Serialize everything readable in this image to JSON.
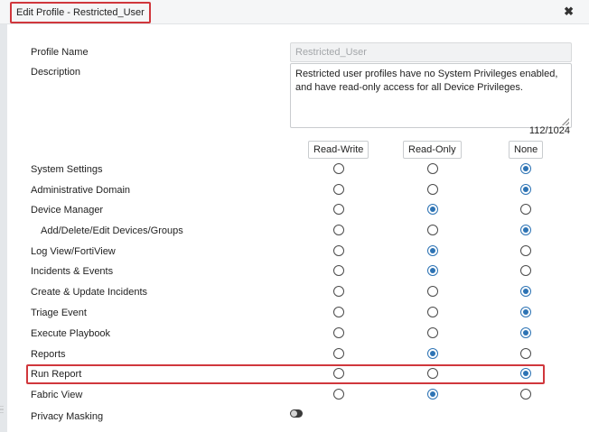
{
  "dialog": {
    "title": "Edit Profile - Restricted_User",
    "close_glyph": "✖",
    "close_icon": "close-icon",
    "grip_icon": "drag-grip-icon"
  },
  "form": {
    "profile_name_label": "Profile Name",
    "profile_name_value": "Restricted_User",
    "description_label": "Description",
    "description_value": "Restricted user profiles have no System Privileges enabled, and have read-only access for all Device Privileges.",
    "char_count": "112/1024"
  },
  "columns": [
    "Read-Write",
    "Read-Only",
    "None"
  ],
  "colors": {
    "accent": "#2d73b4",
    "highlight": "#d0373c"
  },
  "privileges": [
    {
      "label": "System Settings",
      "selected": "None"
    },
    {
      "label": "Administrative Domain",
      "selected": "None"
    },
    {
      "label": "Device Manager",
      "selected": "Read-Only"
    },
    {
      "label": "Add/Delete/Edit Devices/Groups",
      "selected": "None"
    },
    {
      "label": "Log View/FortiView",
      "selected": "Read-Only"
    },
    {
      "label": "Incidents & Events",
      "selected": "Read-Only"
    },
    {
      "label": "Create & Update Incidents",
      "selected": "None"
    },
    {
      "label": "Triage Event",
      "selected": "None"
    },
    {
      "label": "Execute Playbook",
      "selected": "None"
    },
    {
      "label": "Reports",
      "selected": "Read-Only"
    },
    {
      "label": "Run Report",
      "selected": "None"
    },
    {
      "label": "Fabric View",
      "selected": "Read-Only"
    }
  ],
  "privacy_masking": {
    "label": "Privacy Masking",
    "enabled": false
  }
}
